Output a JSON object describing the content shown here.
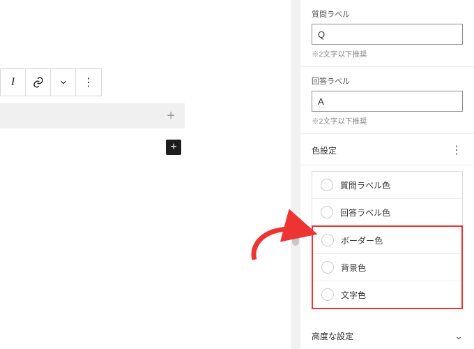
{
  "editor": {
    "toolbar": {
      "italic_label": "I",
      "link_label": "link",
      "chevron_label": "⌄",
      "more_label": "⋮"
    },
    "block_plus": "+",
    "inserter_plus": "+"
  },
  "sidebar": {
    "question": {
      "label": "質問ラベル",
      "value": "Q",
      "hint": "※2文字以下推奨"
    },
    "answer": {
      "label": "回答ラベル",
      "value": "A",
      "hint": "※2文字以下推奨"
    },
    "color_panel": {
      "title": "色設定",
      "items": {
        "question_label_color": "質問ラベル色",
        "answer_label_color": "回答ラベル色",
        "border_color": "ボーダー色",
        "bg_color": "背景色",
        "text_color": "文字色"
      }
    },
    "advanced": {
      "title": "高度な設定"
    }
  },
  "colors": {
    "highlight": "#e33"
  }
}
